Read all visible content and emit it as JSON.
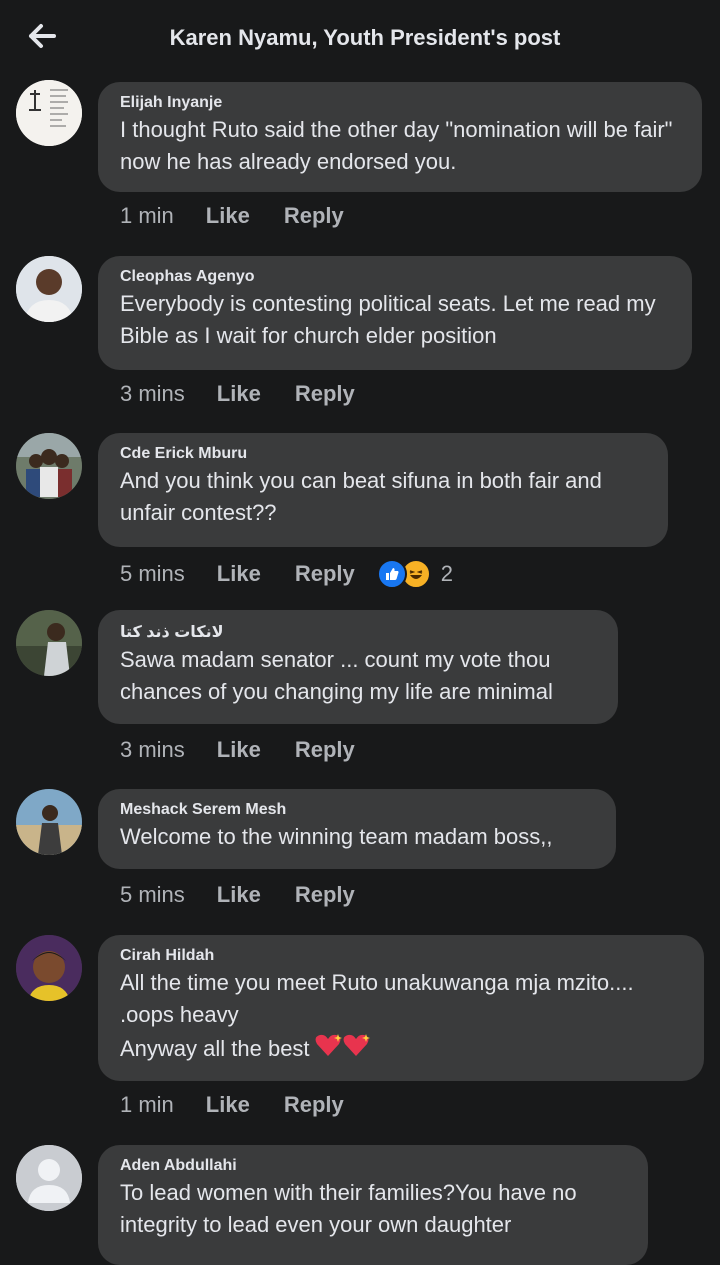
{
  "header": {
    "title": "Karen Nyamu, Youth President's post"
  },
  "comments": [
    {
      "author": "Elijah Inyanje",
      "text": "I thought Ruto said the other day \"nomination will be fair\" now he has already endorsed you.",
      "time": "1 min",
      "like": "Like",
      "reply": "Reply",
      "avatar": "text-image-avatar"
    },
    {
      "author": "Cleophas Agenyo",
      "text": "Everybody is contesting political seats. Let me read my Bible as I wait for church elder position",
      "time": "3 mins",
      "like": "Like",
      "reply": "Reply",
      "avatar": "man-portrait-avatar"
    },
    {
      "author": "Cde Erick Mburu",
      "text": "And you think you can beat sifuna in both fair and unfair contest??",
      "time": "5 mins",
      "like": "Like",
      "reply": "Reply",
      "reaction_count": "2",
      "avatar": "crowd-avatar"
    },
    {
      "author": "لانكات ذند كتا",
      "text": "Sawa madam senator ... count my vote thou chances of you changing my life are minimal",
      "time": "3 mins",
      "like": "Like",
      "reply": "Reply",
      "avatar": "outdoor-avatar"
    },
    {
      "author": "Meshack Serem Mesh",
      "text": "Welcome to the winning team madam boss,,",
      "time": "5 mins",
      "like": "Like",
      "reply": "Reply",
      "avatar": "beach-avatar"
    },
    {
      "author": "Cirah Hildah",
      "line1": "All the time you meet Ruto unakuwanga mja mzito....",
      "line2": ".oops heavy",
      "line3": "Anyway all the best",
      "time": "1 min",
      "like": "Like",
      "reply": "Reply",
      "avatar": "woman-avatar"
    },
    {
      "author": "Aden Abdullahi",
      "text": "To lead women with their families?You have no integrity to lead even your own daughter",
      "avatar": "default-avatar"
    }
  ],
  "colors": {
    "background": "#18191a",
    "bubble": "#3a3b3c",
    "text": "#e4e6eb",
    "meta": "#b0b3b8",
    "like_blue": "#1877f2"
  }
}
